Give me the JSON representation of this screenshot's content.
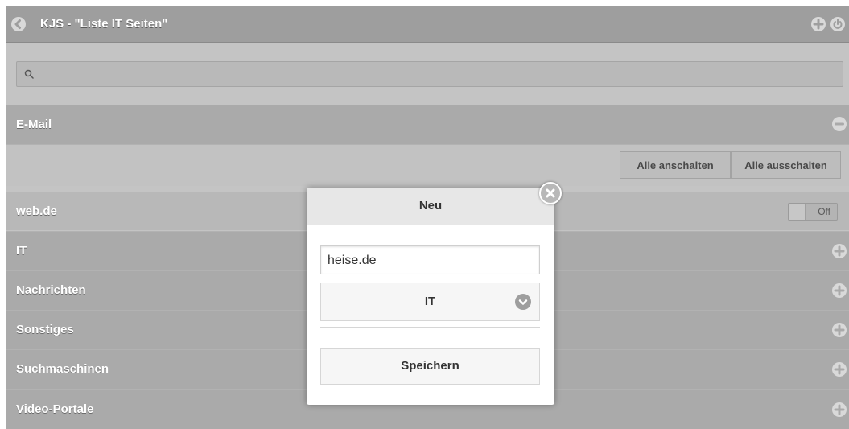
{
  "header": {
    "title": "KJS - \"Liste IT Seiten\""
  },
  "search": {
    "value": "",
    "placeholder": ""
  },
  "email_section": {
    "label": "E-Mail"
  },
  "actions": {
    "all_on": "Alle anschalten",
    "all_off": "Alle ausschalten"
  },
  "entry": {
    "label": "web.de",
    "toggle": "Off"
  },
  "categories": [
    "IT",
    "Nachrichten",
    "Sonstiges",
    "Suchmaschinen",
    "Video-Portale"
  ],
  "dialog": {
    "title": "Neu",
    "url_value": "heise.de",
    "category_selected": "IT",
    "save_label": "Speichern"
  }
}
